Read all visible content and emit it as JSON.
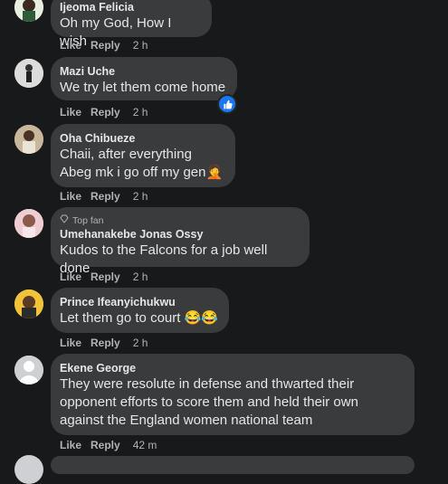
{
  "comments": [
    {
      "author": "Ijeoma Felicia",
      "lines": [
        "Oh my God, How I wish"
      ],
      "like": "Like",
      "reply": "Reply",
      "time": "2 h"
    },
    {
      "author": "Mazi Uche",
      "lines": [
        "We try let them come home"
      ],
      "like": "Like",
      "reply": "Reply",
      "time": "2 h",
      "reaction": "like-reaction-icon"
    },
    {
      "author": "Oha Chibueze",
      "lines": [
        "Chaii, after everything",
        "Abeg mk i go off my gen🤦"
      ],
      "like": "Like",
      "reply": "Reply",
      "time": "2 h"
    },
    {
      "badge": "Top fan",
      "author": "Umehanakebe Jonas Ossy",
      "lines": [
        "Kudos to the Falcons for a job well done"
      ],
      "like": "Like",
      "reply": "Reply",
      "time": "2 h"
    },
    {
      "author": "Prince Ifeanyichukwu",
      "lines": [
        "Let them go to court 😂😂"
      ],
      "like": "Like",
      "reply": "Reply",
      "time": "2 h"
    },
    {
      "author": "Ekene George",
      "lines": [
        "They were resolute in defense and thwarted their",
        "opponent efforts to score them and held their own",
        "against the England women national team"
      ],
      "like": "Like",
      "reply": "Reply",
      "time": "42 m"
    }
  ],
  "colors": {
    "background": "#18191a",
    "bubble": "#3a3b3c",
    "text": "#e4e6eb",
    "muted": "#b0b3b8",
    "accent": "#1877f2"
  }
}
